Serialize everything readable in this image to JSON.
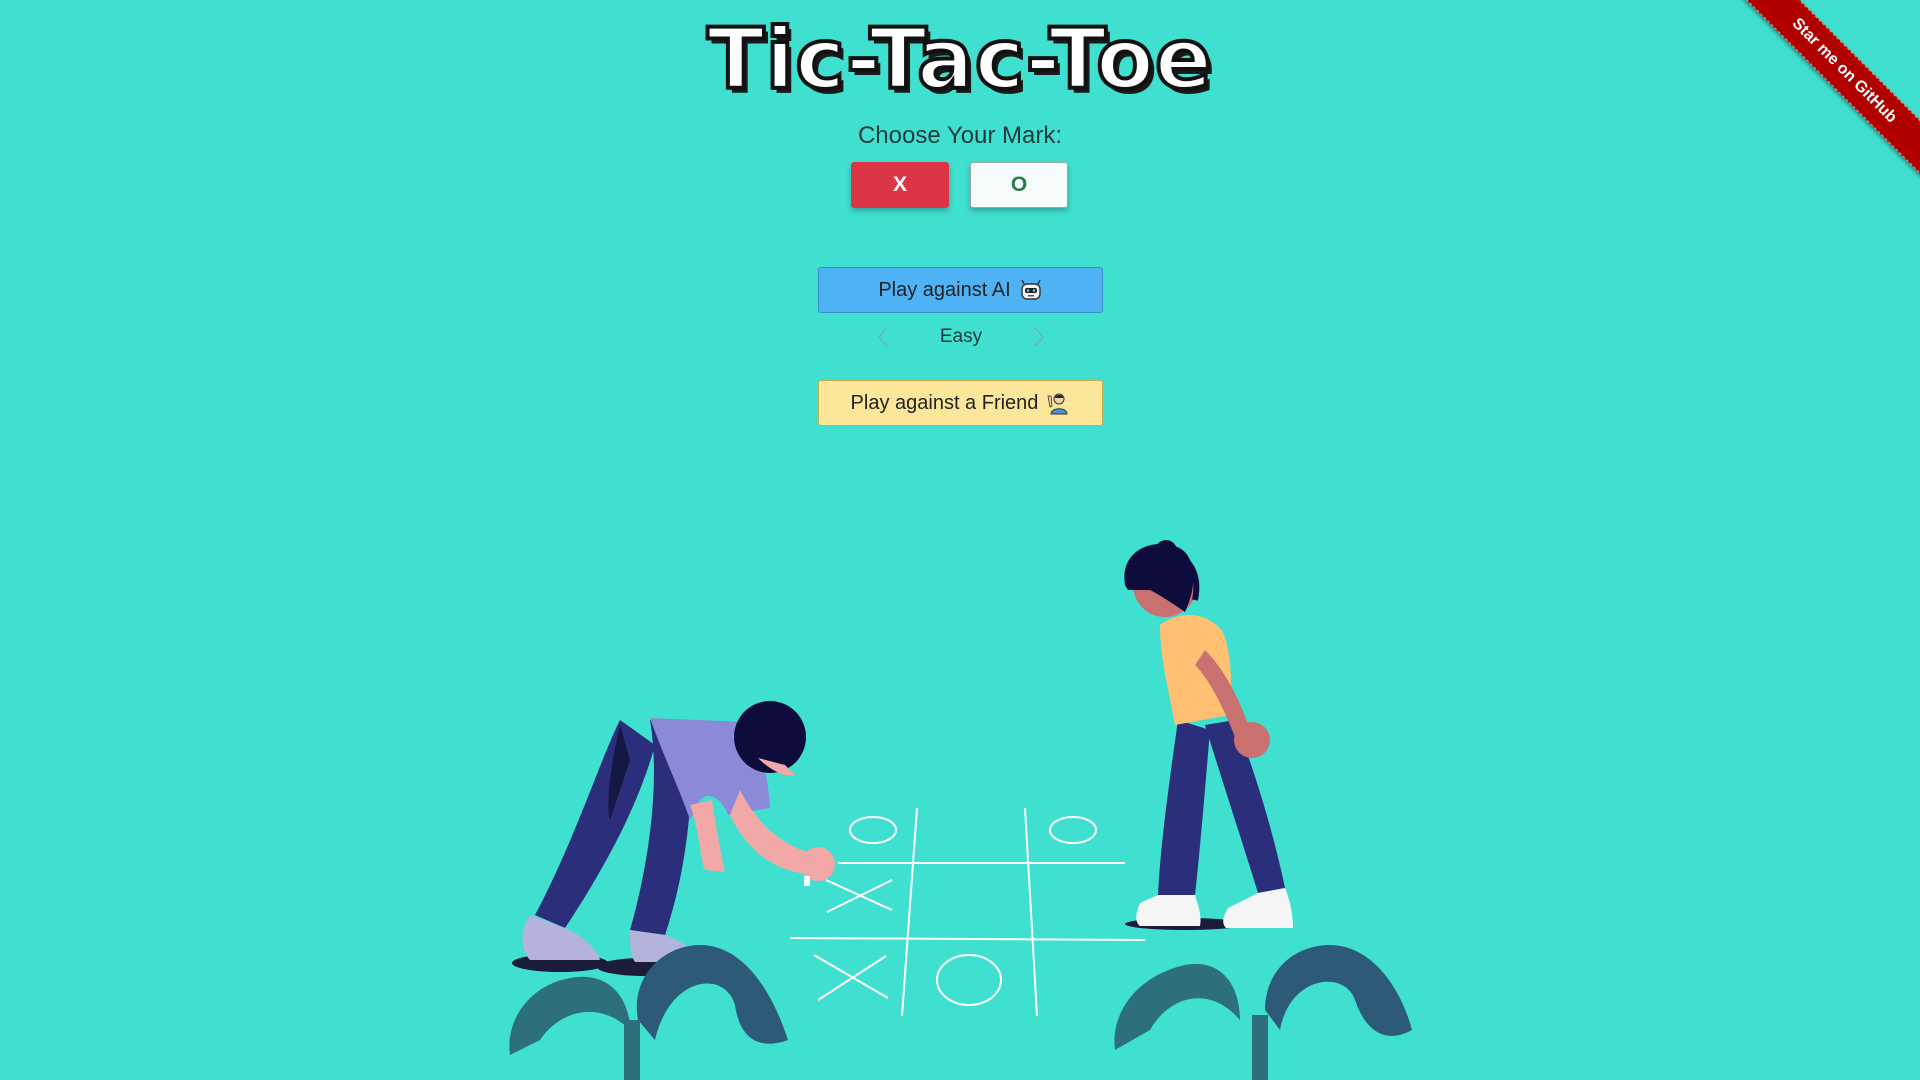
{
  "header": {
    "title": "Tic-Tac-Toe"
  },
  "mark_chooser": {
    "label": "Choose Your Mark:",
    "options": [
      "X",
      "O"
    ],
    "selected": "X",
    "colors": {
      "selected_bg": "#dc3545",
      "unselected_bg": "#f6fbfb"
    }
  },
  "play_ai": {
    "label": "Play against AI",
    "icon": "robot-icon",
    "color": "#4fb2f5"
  },
  "difficulty": {
    "value": "Easy",
    "prev_icon": "chevron-left-icon",
    "next_icon": "chevron-right-icon"
  },
  "play_friend": {
    "label": "Play against a Friend",
    "icon": "waving-person-icon",
    "color": "#fbe69a"
  },
  "ribbon": {
    "label": "Star me on GitHub",
    "color": "#b00000"
  },
  "theme": {
    "background": "#40e0d0"
  }
}
